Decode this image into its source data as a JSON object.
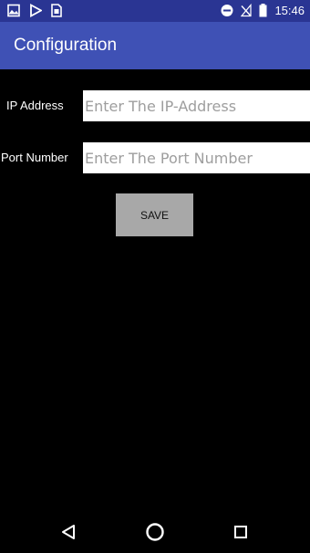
{
  "status_bar": {
    "time": "15:46",
    "left_icons": [
      "image-icon",
      "play-store-icon",
      "sim-card-icon"
    ],
    "right_icons": [
      "do-not-disturb-icon",
      "no-signal-icon",
      "battery-icon"
    ]
  },
  "app_bar": {
    "title": "Configuration",
    "color": "#3f51b5"
  },
  "form": {
    "ip_label": "IP Address",
    "ip_placeholder": "Enter The IP-Address",
    "ip_value": "",
    "port_label": "Port Number",
    "port_placeholder": "Enter The Port Number",
    "port_value": "",
    "save_label": "SAVE"
  },
  "nav_bar": {
    "buttons": [
      "back-icon",
      "home-icon",
      "recents-icon"
    ]
  }
}
